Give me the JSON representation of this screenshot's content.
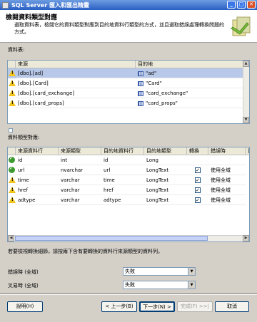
{
  "window": {
    "title": "SQL Server 匯入和匯出精靈"
  },
  "header": {
    "title": "檢閱資料類型對應",
    "description": "選取資料表，檢閱它的資料類型對應到目的地資料行類型的方式，並且選取錯誤處理轉換問題的方式。"
  },
  "tables_section": {
    "label": "資料表:",
    "columns": [
      "來源",
      "目的地"
    ],
    "rows": [
      {
        "source": "[dbo].[ad]",
        "destination": "\"ad\"",
        "icon": "warning-icon",
        "selected": true
      },
      {
        "source": "[dbo].[Card]",
        "destination": "\"Card\"",
        "icon": "warning-icon",
        "selected": false
      },
      {
        "source": "[dbo].[card_exchange]",
        "destination": "\"card_exchange\"",
        "icon": "warning-icon",
        "selected": false
      },
      {
        "source": "[dbo].[card_props]",
        "destination": "\"card_props\"",
        "icon": "warning-icon",
        "selected": false
      }
    ]
  },
  "mapping_section": {
    "label": "資料類型對應:",
    "columns": [
      "來源資料行",
      "來源類型",
      "目的地資料行",
      "目的地類型",
      "轉換",
      "錯誤時",
      "資"
    ],
    "rows": [
      {
        "icon": "ok-icon",
        "source_col": "id",
        "source_type": "int",
        "dest_col": "id",
        "dest_type": "Long",
        "convert": false,
        "on_error": ""
      },
      {
        "icon": "ok-icon",
        "source_col": "url",
        "source_type": "nvarchar",
        "dest_col": "url",
        "dest_type": "LongText",
        "convert": true,
        "on_error": "使用全域"
      },
      {
        "icon": "warning-icon",
        "source_col": "time",
        "source_type": "varchar",
        "dest_col": "time",
        "dest_type": "LongText",
        "convert": true,
        "on_error": "使用全域"
      },
      {
        "icon": "warning-icon",
        "source_col": "href",
        "source_type": "varchar",
        "dest_col": "href",
        "dest_type": "LongText",
        "convert": true,
        "on_error": "使用全域"
      },
      {
        "icon": "warning-icon",
        "source_col": "adtype",
        "source_type": "varchar",
        "dest_col": "adtype",
        "dest_type": "LongText",
        "convert": true,
        "on_error": "使用全域"
      }
    ]
  },
  "hint": "若要檢視轉換細節，請按兩下含有要轉換的資料行來源類型的資料列。",
  "error_options": {
    "on_error_label": "錯誤時 (全域)",
    "on_error_value": "失敗",
    "on_truncation_label": "叉易時 (全域)",
    "on_truncation_value": "失敗"
  },
  "buttons": {
    "help": "說明(H)",
    "back": "< 上一步(B)",
    "next": "下一步(N) >",
    "finish": "完成(F) >>|",
    "cancel": "取消"
  },
  "colors": {
    "titlebar": "#2a5fc4",
    "selected_row": "#b8c8e8",
    "warning": "#f3c51b",
    "ok": "#3c9a2f"
  }
}
